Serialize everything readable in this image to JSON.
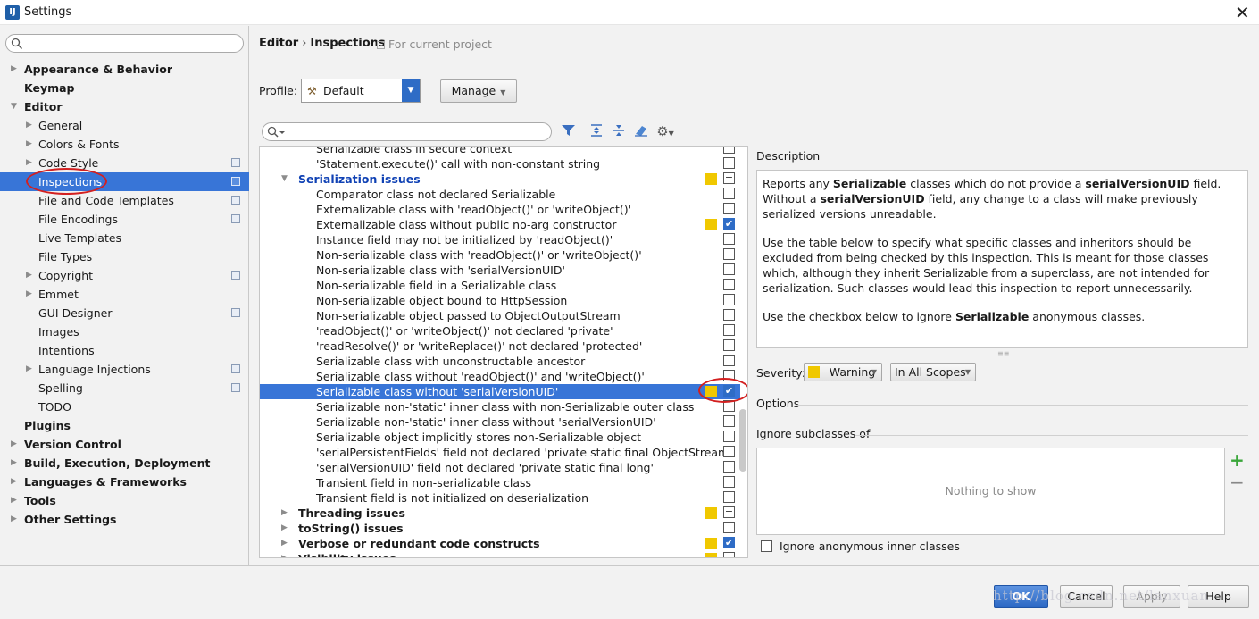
{
  "window": {
    "app_icon_text": "IJ",
    "title": "Settings",
    "close_glyph": "✕"
  },
  "sidebar": {
    "search_placeholder": "",
    "items": [
      {
        "label": "Appearance & Behavior",
        "level": 0,
        "arrow": "▶",
        "bold": true
      },
      {
        "label": "Keymap",
        "level": 0,
        "arrow": "",
        "bold": true
      },
      {
        "label": "Editor",
        "level": 0,
        "arrow": "▼",
        "bold": true
      },
      {
        "label": "General",
        "level": 1,
        "arrow": "▶"
      },
      {
        "label": "Colors & Fonts",
        "level": 1,
        "arrow": "▶"
      },
      {
        "label": "Code Style",
        "level": 1,
        "arrow": "▶",
        "proj": true
      },
      {
        "label": "Inspections",
        "level": 1,
        "arrow": "",
        "proj": true,
        "selected": true
      },
      {
        "label": "File and Code Templates",
        "level": 1,
        "arrow": "",
        "proj": true
      },
      {
        "label": "File Encodings",
        "level": 1,
        "arrow": "",
        "proj": true
      },
      {
        "label": "Live Templates",
        "level": 1,
        "arrow": ""
      },
      {
        "label": "File Types",
        "level": 1,
        "arrow": ""
      },
      {
        "label": "Copyright",
        "level": 1,
        "arrow": "▶",
        "proj": true
      },
      {
        "label": "Emmet",
        "level": 1,
        "arrow": "▶"
      },
      {
        "label": "GUI Designer",
        "level": 1,
        "arrow": "",
        "proj": true
      },
      {
        "label": "Images",
        "level": 1,
        "arrow": ""
      },
      {
        "label": "Intentions",
        "level": 1,
        "arrow": ""
      },
      {
        "label": "Language Injections",
        "level": 1,
        "arrow": "▶",
        "proj": true
      },
      {
        "label": "Spelling",
        "level": 1,
        "arrow": "",
        "proj": true
      },
      {
        "label": "TODO",
        "level": 1,
        "arrow": ""
      },
      {
        "label": "Plugins",
        "level": 0,
        "arrow": "",
        "bold": true
      },
      {
        "label": "Version Control",
        "level": 0,
        "arrow": "▶",
        "bold": true
      },
      {
        "label": "Build, Execution, Deployment",
        "level": 0,
        "arrow": "▶",
        "bold": true
      },
      {
        "label": "Languages & Frameworks",
        "level": 0,
        "arrow": "▶",
        "bold": true
      },
      {
        "label": "Tools",
        "level": 0,
        "arrow": "▶",
        "bold": true
      },
      {
        "label": "Other Settings",
        "level": 0,
        "arrow": "▶",
        "bold": true
      }
    ]
  },
  "breadcrumb": {
    "parent": "Editor",
    "separator": "›",
    "current": "Inspections",
    "note": "For current project"
  },
  "profile": {
    "label": "Profile:",
    "value": "Default",
    "manage_label": "Manage",
    "dropdown_glyph": "▼"
  },
  "inspections": [
    {
      "label": "Serializable class in secure context",
      "group": false,
      "check": "off"
    },
    {
      "label": "'Statement.execute()' call with non-constant string",
      "group": false,
      "check": "off"
    },
    {
      "label": "Serialization issues",
      "group": true,
      "expanded": true,
      "blue": true,
      "sev": true,
      "check": "mixed"
    },
    {
      "label": "Comparator class not declared Serializable",
      "group": false,
      "check": "off"
    },
    {
      "label": "Externalizable class with 'readObject()' or 'writeObject()'",
      "group": false,
      "check": "off"
    },
    {
      "label": "Externalizable class without public no-arg constructor",
      "group": false,
      "sev": true,
      "check": "on"
    },
    {
      "label": "Instance field may not be initialized by 'readObject()'",
      "group": false,
      "check": "off"
    },
    {
      "label": "Non-serializable class with 'readObject()' or 'writeObject()'",
      "group": false,
      "check": "off"
    },
    {
      "label": "Non-serializable class with 'serialVersionUID'",
      "group": false,
      "check": "off"
    },
    {
      "label": "Non-serializable field in a Serializable class",
      "group": false,
      "check": "off"
    },
    {
      "label": "Non-serializable object bound to HttpSession",
      "group": false,
      "check": "off"
    },
    {
      "label": "Non-serializable object passed to ObjectOutputStream",
      "group": false,
      "check": "off"
    },
    {
      "label": "'readObject()' or 'writeObject()' not declared 'private'",
      "group": false,
      "check": "off"
    },
    {
      "label": "'readResolve()' or 'writeReplace()' not declared 'protected'",
      "group": false,
      "check": "off"
    },
    {
      "label": "Serializable class with unconstructable ancestor",
      "group": false,
      "check": "off"
    },
    {
      "label": "Serializable class without 'readObject()' and 'writeObject()'",
      "group": false,
      "check": "off"
    },
    {
      "label": "Serializable class without 'serialVersionUID'",
      "group": false,
      "sev": true,
      "check": "on",
      "selected": true
    },
    {
      "label": "Serializable non-'static' inner class with non-Serializable outer class",
      "group": false,
      "check": "off"
    },
    {
      "label": "Serializable non-'static' inner class without 'serialVersionUID'",
      "group": false,
      "check": "off"
    },
    {
      "label": "Serializable object implicitly stores non-Serializable object",
      "group": false,
      "check": "off"
    },
    {
      "label": "'serialPersistentFields' field not declared 'private static final ObjectStreamF",
      "group": false,
      "check": "off"
    },
    {
      "label": "'serialVersionUID' field not declared 'private static final long'",
      "group": false,
      "check": "off"
    },
    {
      "label": "Transient field in non-serializable class",
      "group": false,
      "check": "off"
    },
    {
      "label": "Transient field is not initialized on deserialization",
      "group": false,
      "check": "off"
    },
    {
      "label": "Threading issues",
      "group": true,
      "expanded": false,
      "sev": true,
      "check": "mixed"
    },
    {
      "label": "toString() issues",
      "group": true,
      "expanded": false,
      "check": "off"
    },
    {
      "label": "Verbose or redundant code constructs",
      "group": true,
      "expanded": false,
      "sev": true,
      "check": "on"
    },
    {
      "label": "Visibility issues",
      "group": true,
      "expanded": false,
      "sev": true,
      "check": "off"
    }
  ],
  "description": {
    "label": "Description",
    "p1": [
      "Reports any ",
      "Serializable",
      " classes which do not provide a ",
      "serialVersionUID",
      " field. Without a ",
      "serialVersionUID",
      " field, any change to a class will make previously serialized versions unreadable."
    ],
    "p2": "Use the table below to specify what specific classes and inheritors should be excluded from being checked by this inspection. This is meant for those classes which, although they inherit Serializable from a superclass, are not intended for serialization. Such classes would lead this inspection to report unnecessarily.",
    "p3": [
      "Use the checkbox below to ignore ",
      "Serializable",
      " anonymous classes."
    ]
  },
  "severity": {
    "label": "Severity:",
    "value": "Warning",
    "scope": "In All Scopes",
    "color": "#f0c800"
  },
  "options": {
    "label": "Options",
    "ignore_subclasses_label": "Ignore subclasses of",
    "empty_text": "Nothing to show",
    "add_glyph": "+",
    "remove_glyph": "−",
    "ignore_anon_label": "Ignore anonymous inner classes"
  },
  "buttons": {
    "ok": "OK",
    "cancel": "Cancel",
    "apply": "Apply",
    "help": "Help"
  },
  "watermark": "http://blog.csdn.net/lanxuan",
  "colors": {
    "selection": "#3875d7",
    "accent": "#2e6cc6",
    "warning": "#f0c800",
    "annotation": "#d32020"
  }
}
